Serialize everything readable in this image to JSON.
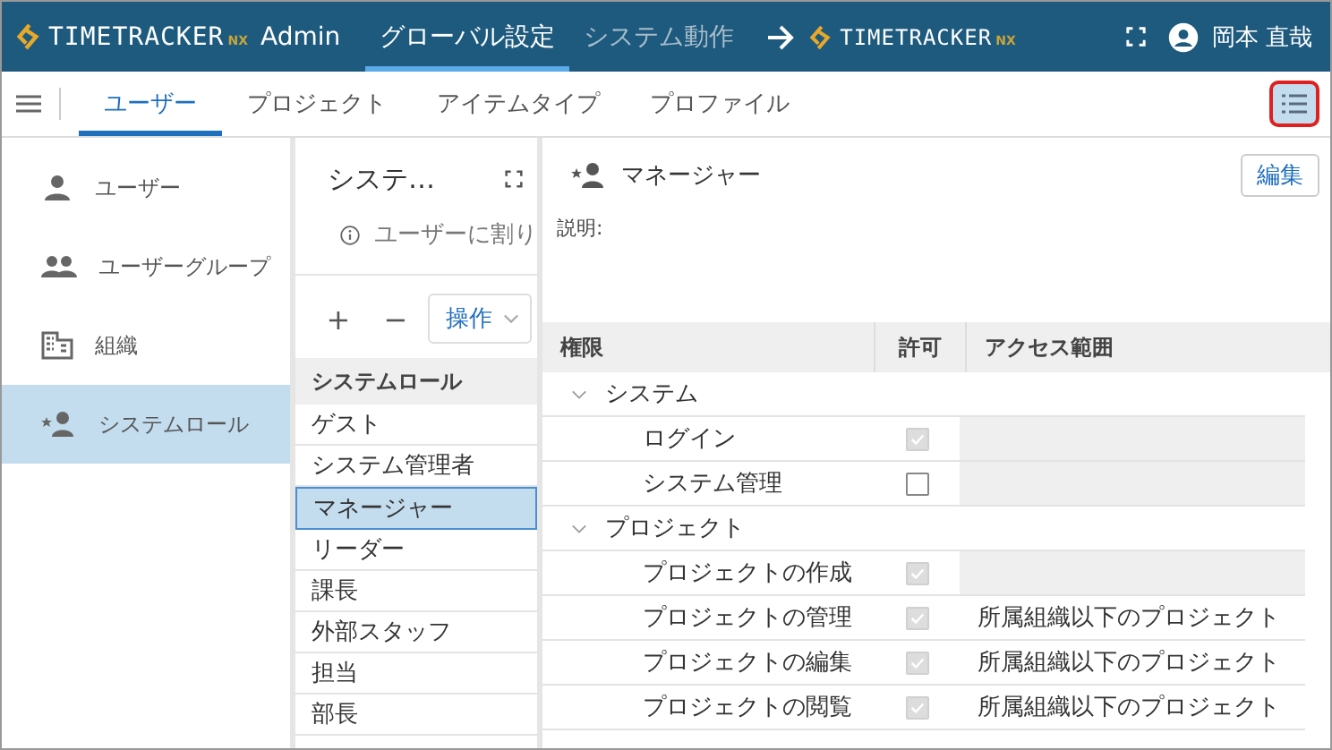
{
  "header": {
    "logo": {
      "name": "TIMETRACKER",
      "suffix": "NX",
      "app": "Admin"
    },
    "nav": [
      {
        "label": "グローバル設定",
        "selected": true
      },
      {
        "label": "システム動作",
        "selected": false
      }
    ],
    "target_logo": {
      "name": "TIMETRACKER",
      "suffix": "NX"
    },
    "user": "岡本 直哉"
  },
  "tabs": [
    {
      "label": "ユーザー",
      "selected": true
    },
    {
      "label": "プロジェクト",
      "selected": false
    },
    {
      "label": "アイテムタイプ",
      "selected": false
    },
    {
      "label": "プロファイル",
      "selected": false
    }
  ],
  "list_toggle": {
    "on": true
  },
  "sidebar": {
    "items": [
      {
        "label": "ユーザー",
        "kind": "user",
        "selected": false
      },
      {
        "label": "ユーザーグループ",
        "kind": "group",
        "selected": false
      },
      {
        "label": "組織",
        "kind": "org",
        "selected": false
      },
      {
        "label": "システムロール",
        "kind": "role",
        "selected": true
      }
    ]
  },
  "list_pane": {
    "title": "システ…",
    "info": "ユーザーに割り",
    "add": "+",
    "remove": "−",
    "action": "操作",
    "column": "システムロール",
    "rows": [
      {
        "label": "ゲスト",
        "selected": false
      },
      {
        "label": "システム管理者",
        "selected": false
      },
      {
        "label": "マネージャー",
        "selected": true
      },
      {
        "label": "リーダー",
        "selected": false
      },
      {
        "label": "課長",
        "selected": false
      },
      {
        "label": "外部スタッフ",
        "selected": false
      },
      {
        "label": "担当",
        "selected": false
      },
      {
        "label": "部長",
        "selected": false
      }
    ]
  },
  "detail": {
    "title": "マネージャー",
    "edit": "編集",
    "description_label": "説明:",
    "columns": [
      "権限",
      "許可",
      "アクセス範囲"
    ],
    "groups": [
      {
        "label": "システム",
        "expanded": true,
        "children": [
          {
            "name": "ログイン",
            "checked": true,
            "disabled": true
          },
          {
            "name": "システム管理",
            "checked": false,
            "disabled": false
          }
        ]
      },
      {
        "label": "プロジェクト",
        "expanded": true,
        "children": [
          {
            "name": "プロジェクトの作成",
            "checked": true,
            "disabled": true
          },
          {
            "name": "プロジェクトの管理",
            "checked": true,
            "disabled": true,
            "scope": "所属組織以下のプロジェクト"
          },
          {
            "name": "プロジェクトの編集",
            "checked": true,
            "disabled": true,
            "scope": "所属組織以下のプロジェクト"
          },
          {
            "name": "プロジェクトの閲覧",
            "checked": true,
            "disabled": true,
            "scope": "所属組織以下のプロジェクト"
          }
        ]
      }
    ]
  }
}
